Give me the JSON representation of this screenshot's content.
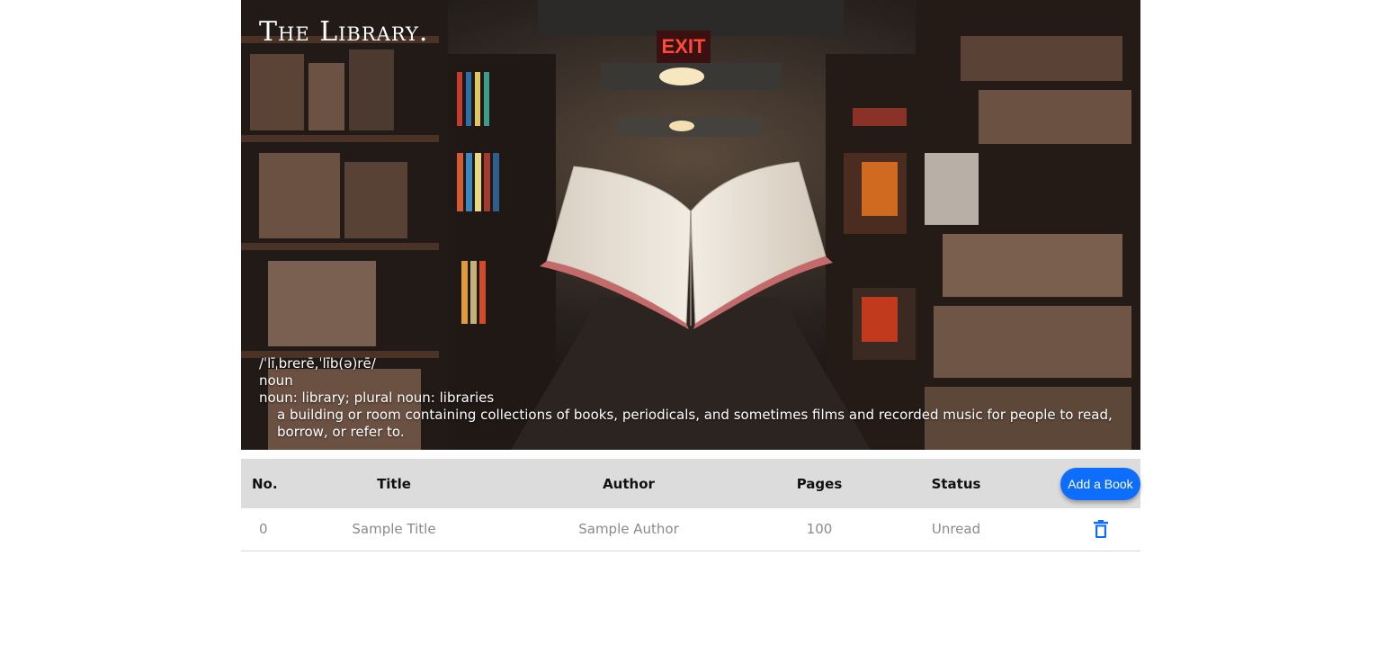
{
  "hero": {
    "title": "The Library.",
    "definition": {
      "pronunciation": "/ˈlīˌbrerē,ˈlīb(ə)rē/",
      "part_of_speech": "noun",
      "forms": "noun: library; plural noun: libraries",
      "meaning": "a building or room containing collections of books, periodicals, and sometimes films and recorded music for people to read, borrow, or refer to."
    },
    "exit_sign": "EXIT"
  },
  "table": {
    "headers": {
      "no": "No.",
      "title": "Title",
      "author": "Author",
      "pages": "Pages",
      "status": "Status"
    },
    "add_button_label": "Add a Book",
    "rows": [
      {
        "no": "0",
        "title": "Sample Title",
        "author": "Sample Author",
        "pages": "100",
        "status": "Unread",
        "delete_icon": "trash-icon"
      }
    ]
  },
  "colors": {
    "accent": "#0d6efd",
    "header_bg": "#dcdcdc",
    "cell_text": "#8a8a8a"
  }
}
